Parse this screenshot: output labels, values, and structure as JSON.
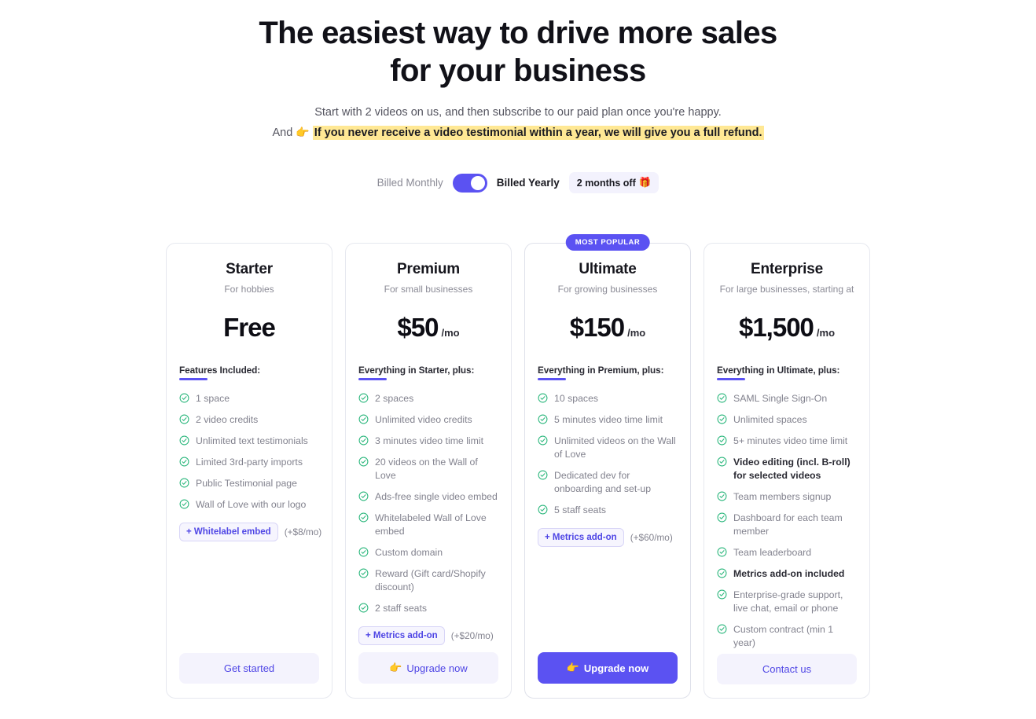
{
  "hero": {
    "title_line1": "The easiest way to drive more sales",
    "title_line2": "for your business",
    "sub_line1": "Start with 2 videos on us, and then subscribe to our paid plan once you're happy.",
    "sub_line2_prefix": "And",
    "sub_line2_emoji": "👉",
    "sub_line2_highlight": "If you never receive a video testimonial within a year, we will give you a full refund."
  },
  "billing": {
    "monthly_label": "Billed Monthly",
    "yearly_label": "Billed Yearly",
    "toggle_state": "yearly",
    "discount_label": "2 months off",
    "discount_emoji": "🎁"
  },
  "colors": {
    "accent": "#5b52f2",
    "accent_soft": "#f4f3fd",
    "check_green": "#2eb87e",
    "highlight_yellow": "#ffe894",
    "card_border": "#e6e8ef",
    "muted_text": "#82828e"
  },
  "icons": {
    "check": "check-circle-icon",
    "hand": "pointing-hand-icon",
    "gift": "gift-icon"
  },
  "plans": [
    {
      "name": "Starter",
      "tagline": "For hobbies",
      "price": "Free",
      "period": "",
      "featured": false,
      "badge": "",
      "features_head": "Features Included:",
      "features": [
        {
          "text": "1 space",
          "bold": false
        },
        {
          "text": "2 video credits",
          "bold": false
        },
        {
          "text": "Unlimited text testimonials",
          "bold": false
        },
        {
          "text": "Limited 3rd-party imports",
          "bold": false
        },
        {
          "text": "Public Testimonial page",
          "bold": false
        },
        {
          "text": "Wall of Love with our logo",
          "bold": false
        }
      ],
      "addon": {
        "label": "+ Whitelabel embed",
        "price": "(+$8/mo)"
      },
      "cta": {
        "label": "Get started",
        "style": "ghost",
        "emoji": ""
      }
    },
    {
      "name": "Premium",
      "tagline": "For small businesses",
      "price": "$50",
      "period": "/mo",
      "featured": false,
      "badge": "",
      "features_head": "Everything in Starter, plus:",
      "features": [
        {
          "text": "2 spaces",
          "bold": false
        },
        {
          "text": "Unlimited video credits",
          "bold": false
        },
        {
          "text": "3 minutes video time limit",
          "bold": false
        },
        {
          "text": "20 videos on the Wall of Love",
          "bold": false
        },
        {
          "text": "Ads-free single video embed",
          "bold": false
        },
        {
          "text": "Whitelabeled Wall of Love embed",
          "bold": false
        },
        {
          "text": "Custom domain",
          "bold": false
        },
        {
          "text": "Reward (Gift card/Shopify discount)",
          "bold": false
        },
        {
          "text": "2 staff seats",
          "bold": false
        }
      ],
      "addon": {
        "label": "+ Metrics add-on",
        "price": "(+$20/mo)"
      },
      "cta": {
        "label": "Upgrade now",
        "style": "ghost",
        "emoji": "👉"
      }
    },
    {
      "name": "Ultimate",
      "tagline": "For growing businesses",
      "price": "$150",
      "period": "/mo",
      "featured": true,
      "badge": "MOST POPULAR",
      "features_head": "Everything in Premium, plus:",
      "features": [
        {
          "text": "10 spaces",
          "bold": false
        },
        {
          "text": "5 minutes video time limit",
          "bold": false
        },
        {
          "text": "Unlimited videos on the Wall of Love",
          "bold": false
        },
        {
          "text": "Dedicated dev for onboarding and set-up",
          "bold": false
        },
        {
          "text": "5 staff seats",
          "bold": false
        }
      ],
      "addon": {
        "label": "+ Metrics add-on",
        "price": "(+$60/mo)"
      },
      "cta": {
        "label": "Upgrade now",
        "style": "solid",
        "emoji": "👉"
      }
    },
    {
      "name": "Enterprise",
      "tagline": "For large businesses, starting at",
      "price": "$1,500",
      "period": "/mo",
      "featured": false,
      "badge": "",
      "features_head": "Everything in Ultimate, plus:",
      "features": [
        {
          "text": "SAML Single Sign-On",
          "bold": false
        },
        {
          "text": "Unlimited spaces",
          "bold": false
        },
        {
          "text": "5+ minutes video time limit",
          "bold": false
        },
        {
          "text": "Video editing (incl. B-roll) for selected videos",
          "bold": true
        },
        {
          "text": "Team members signup",
          "bold": false
        },
        {
          "text": "Dashboard for each team member",
          "bold": false
        },
        {
          "text": "Team leaderboard",
          "bold": false
        },
        {
          "text": "Metrics add-on included",
          "bold": true
        },
        {
          "text": "Enterprise-grade support, live chat, email or phone",
          "bold": false
        },
        {
          "text": "Custom contract (min 1 year)",
          "bold": false
        }
      ],
      "addon": null,
      "cta": {
        "label": "Contact us",
        "style": "ghost",
        "emoji": ""
      }
    }
  ]
}
